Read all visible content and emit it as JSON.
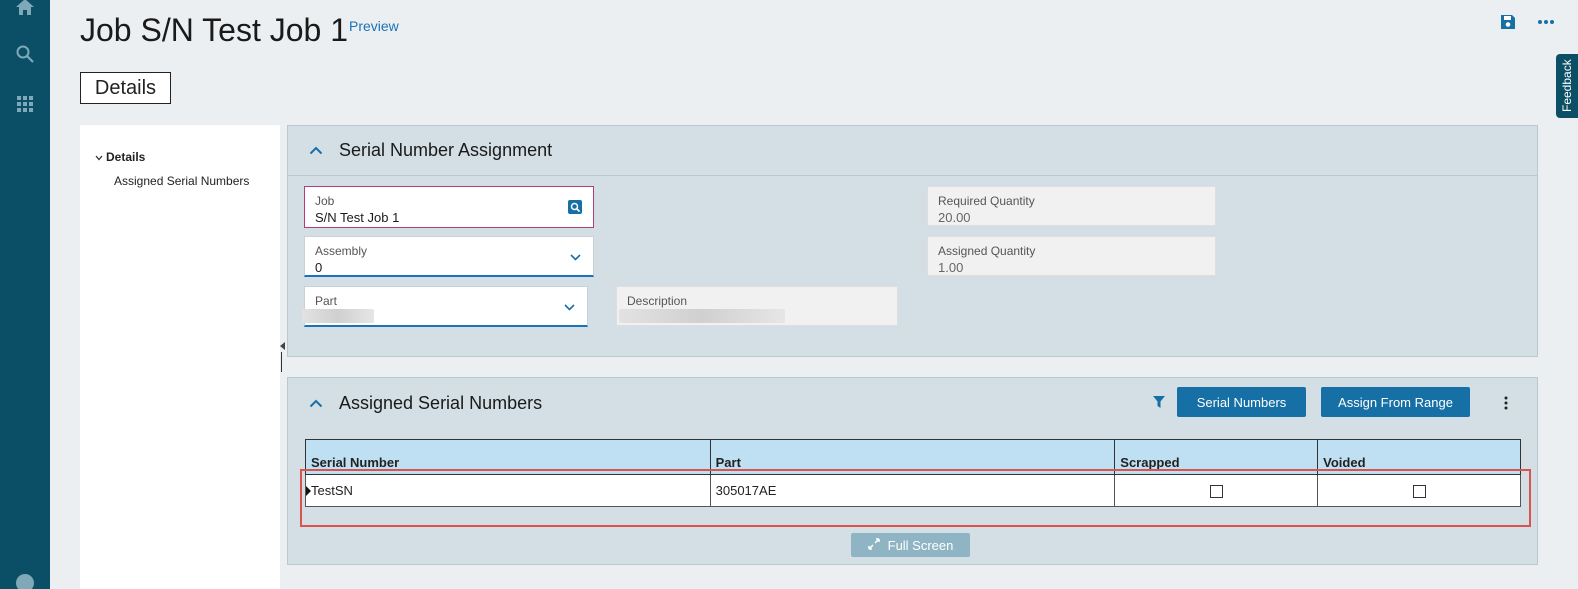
{
  "header": {
    "title": "Job S/N Test Job 1",
    "preview_label": "Preview",
    "details_tab": "Details",
    "feedback_label": "Feedback"
  },
  "tree": {
    "root_label": "Details",
    "child_label": "Assigned Serial Numbers"
  },
  "serial_assignment": {
    "title": "Serial Number Assignment",
    "job": {
      "label": "Job",
      "value": "S/N Test Job 1"
    },
    "assembly": {
      "label": "Assembly",
      "value": "0"
    },
    "part": {
      "label": "Part",
      "value": ""
    },
    "description": {
      "label": "Description",
      "value": ""
    },
    "required_qty": {
      "label": "Required Quantity",
      "value": "20.00"
    },
    "assigned_qty": {
      "label": "Assigned Quantity",
      "value": "1.00"
    }
  },
  "assigned_serials": {
    "title": "Assigned Serial Numbers",
    "serial_numbers_button": "Serial Numbers",
    "assign_range_button": "Assign From Range",
    "columns": [
      "Serial Number",
      "Part",
      "Scrapped",
      "Voided"
    ],
    "rows": [
      {
        "serial": "TestSN",
        "part": "305017AE",
        "scrapped": false,
        "voided": false
      }
    ],
    "full_screen_label": "Full Screen"
  },
  "icons": {
    "rail": [
      "home-icon",
      "search-icon",
      "apps-grid-icon",
      "help-icon"
    ],
    "top": [
      "save-icon",
      "more-horizontal-icon"
    ]
  },
  "colors": {
    "rail": "#0b4f66",
    "primary_button": "#1670a6",
    "grid_header": "#bfe0f2",
    "highlight": "#d9534f"
  }
}
